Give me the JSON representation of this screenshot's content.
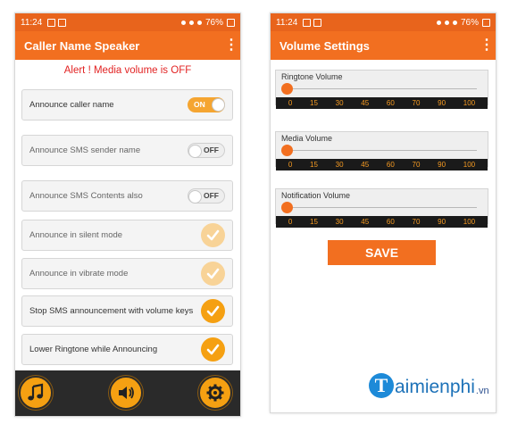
{
  "status_bar": {
    "time": "11:24",
    "battery": "76%"
  },
  "left_screen": {
    "title": "Caller Name Speaker",
    "alert": "Alert ! Media volume is OFF",
    "settings": [
      {
        "label": "Announce caller name",
        "control": "toggle",
        "state": "ON",
        "enabled": true
      },
      {
        "label": "Announce SMS sender name",
        "control": "toggle",
        "state": "OFF",
        "enabled": false
      },
      {
        "label": "Announce SMS Contents also",
        "control": "toggle",
        "state": "OFF",
        "enabled": false
      },
      {
        "label": "Announce in silent mode",
        "control": "checkbox",
        "checked": true,
        "enabled": false
      },
      {
        "label": "Announce in vibrate mode",
        "control": "checkbox",
        "checked": true,
        "enabled": false
      },
      {
        "label": "Stop SMS announcement with volume keys",
        "control": "checkbox",
        "checked": true,
        "enabled": true
      },
      {
        "label": "Lower Ringtone while Announcing",
        "control": "checkbox",
        "checked": true,
        "enabled": true
      }
    ],
    "bottom_nav": [
      "music-note-icon",
      "speaker-volume-icon",
      "settings-gear-icon"
    ]
  },
  "right_screen": {
    "title": "Volume Settings",
    "sliders": [
      {
        "label": "Ringtone Volume",
        "value": 0
      },
      {
        "label": "Media Volume",
        "value": 0
      },
      {
        "label": "Notification Volume",
        "value": 0
      }
    ],
    "scale": [
      "0",
      "15",
      "30",
      "45",
      "60",
      "70",
      "90",
      "100"
    ],
    "save_label": "SAVE"
  },
  "watermark": {
    "main": "aimienphi",
    "suffix": ".vn"
  },
  "colors": {
    "accent": "#f26f20",
    "status_bar": "#e8641c",
    "check_active": "#f5a012",
    "alert": "#e22323",
    "bottom_bar": "#2a2a2a"
  }
}
